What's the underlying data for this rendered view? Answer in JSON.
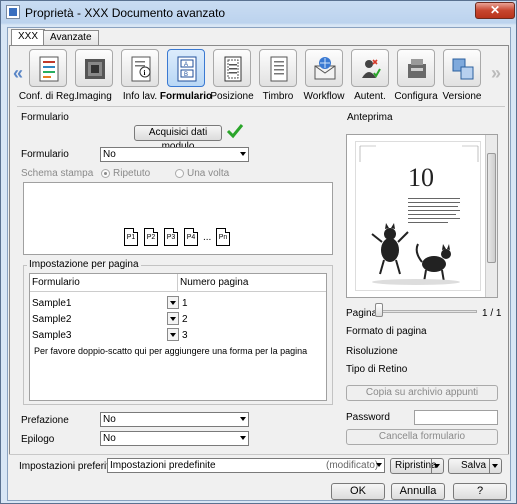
{
  "window": {
    "title": "Proprietà - XXX Documento avanzato",
    "close_glyph": "✕"
  },
  "tabs": [
    {
      "label": "XXX"
    },
    {
      "label": "Avanzate"
    }
  ],
  "toolbar": {
    "prev_glyph": "«",
    "next_glyph": "»",
    "items": [
      {
        "label": "Conf. di Reg.",
        "icon": "registration-icon"
      },
      {
        "label": "Imaging",
        "icon": "imaging-icon"
      },
      {
        "label": "Info lav.",
        "icon": "job-info-icon"
      },
      {
        "label": "Formulario",
        "icon": "form-icon",
        "active": true
      },
      {
        "label": "Posizione",
        "icon": "position-icon"
      },
      {
        "label": "Timbro",
        "icon": "stamp-icon"
      },
      {
        "label": "Workflow",
        "icon": "workflow-icon"
      },
      {
        "label": "Autent.",
        "icon": "authentication-icon"
      },
      {
        "label": "Configura",
        "icon": "configure-icon"
      },
      {
        "label": "Versione",
        "icon": "version-icon"
      }
    ]
  },
  "form": {
    "section_title": "Formulario",
    "acquire_button": "Acquisici dati modulo",
    "formulario_label": "Formulario",
    "formulario_value": "No",
    "schema_label": "Schema stampa",
    "radio_repeat": "Ripetuto",
    "radio_once": "Una volta",
    "pages": [
      "P1",
      "P2",
      "P3",
      "P4",
      "...",
      "Pn"
    ],
    "per_page_title": "Impostazione per pagina",
    "grid_headers": {
      "form": "Formulario",
      "page": "Numero pagina"
    },
    "rows": [
      {
        "name": "Sample1",
        "page": "1"
      },
      {
        "name": "Sample2",
        "page": "2"
      },
      {
        "name": "Sample3",
        "page": "3"
      }
    ],
    "grid_hint": "Per favore doppio-scatto qui per aggiungere una forma per la pagina",
    "prefazione_label": "Prefazione",
    "prefazione_value": "No",
    "epilogo_label": "Epilogo",
    "epilogo_value": "No"
  },
  "preview": {
    "title": "Anteprima",
    "page_number": "10",
    "page_label": "Pagina",
    "page_count": "1 / 1",
    "format_label": "Formato di pagina",
    "resolution_label": "Risoluzione",
    "retino_label": "Tipo di Retino",
    "copy_button": "Copia su archivio appunti",
    "password_label": "Password",
    "clear_button": "Cancella formulario"
  },
  "presets": {
    "label": "Impostazioni preferite",
    "value": "Impostazioni predefinite",
    "modified": "(modificato)",
    "restore_button": "Ripristina",
    "save_button": "Salva"
  },
  "footer": {
    "ok": "OK",
    "cancel": "Annulla",
    "help": "?"
  },
  "colors": {
    "accent": "#3a79d2",
    "check": "#2aa52a",
    "title_bg": "#c9dcf2"
  }
}
